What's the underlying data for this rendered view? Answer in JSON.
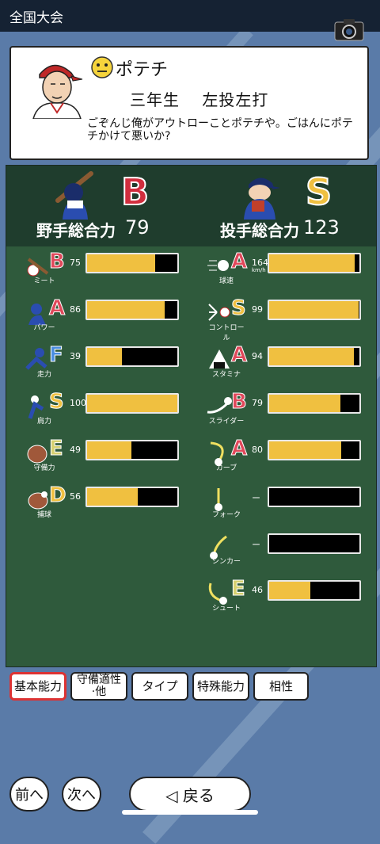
{
  "header": {
    "title": "全国大会"
  },
  "player": {
    "name": "ポテチ",
    "info": "三年生　 左投左打",
    "quote": "ごぞんじ俺がアウトローことポテチや。ごはんにポテチかけて悪いか?"
  },
  "colors": {
    "bar_fill": "#f0c040",
    "grade_S": "#f0c040",
    "grade_A": "#e0485a",
    "grade_B": "#e0485a",
    "grade_D": "#f0c040",
    "grade_E": "#d6d070",
    "grade_F": "#4a8de0"
  },
  "batting": {
    "total_label": "野手総合力",
    "rank": "B",
    "total": "79",
    "stats": [
      {
        "label": "ミート",
        "grade": "B",
        "value": "75",
        "fill": 0.75,
        "icon": "bat-icon"
      },
      {
        "label": "パワー",
        "grade": "A",
        "value": "86",
        "fill": 0.86,
        "icon": "power-swing-icon"
      },
      {
        "label": "走力",
        "grade": "F",
        "value": "39",
        "fill": 0.39,
        "icon": "runner-icon"
      },
      {
        "label": "肩力",
        "grade": "S",
        "value": "100",
        "fill": 1.0,
        "icon": "throw-icon"
      },
      {
        "label": "守備力",
        "grade": "E",
        "value": "49",
        "fill": 0.49,
        "icon": "glove-icon"
      },
      {
        "label": "捕球",
        "grade": "D",
        "value": "56",
        "fill": 0.56,
        "icon": "catch-icon"
      }
    ]
  },
  "pitching": {
    "total_label": "投手総合力",
    "rank": "S",
    "total": "123",
    "stats": [
      {
        "label": "球速",
        "grade": "A",
        "value": "164",
        "unit": "km/h",
        "fill": 0.95,
        "icon": "fastball-icon"
      },
      {
        "label": "コントロール",
        "grade": "S",
        "value": "99",
        "fill": 0.99,
        "icon": "control-icon"
      },
      {
        "label": "スタミナ",
        "grade": "A",
        "value": "94",
        "fill": 0.94,
        "icon": "onigiri-icon"
      },
      {
        "label": "スライダー",
        "grade": "B",
        "value": "79",
        "fill": 0.79,
        "icon": "slider-icon"
      },
      {
        "label": "カーブ",
        "grade": "A",
        "value": "80",
        "fill": 0.8,
        "icon": "curve-icon"
      },
      {
        "label": "フォーク",
        "grade": "",
        "value": "ー",
        "fill": 0,
        "icon": "fork-icon"
      },
      {
        "label": "シンカー",
        "grade": "",
        "value": "ー",
        "fill": 0,
        "icon": "sinker-icon"
      },
      {
        "label": "シュート",
        "grade": "E",
        "value": "46",
        "fill": 0.46,
        "icon": "shoot-icon"
      }
    ]
  },
  "tabs": [
    {
      "label": "基本能力",
      "active": true
    },
    {
      "label": "守備適性\n·他",
      "active": false
    },
    {
      "label": "タイプ",
      "active": false
    },
    {
      "label": "特殊能力",
      "active": false
    },
    {
      "label": "相性",
      "active": false
    }
  ],
  "nav": {
    "prev": "前へ",
    "next": "次へ",
    "back": "◁ 戻る"
  }
}
